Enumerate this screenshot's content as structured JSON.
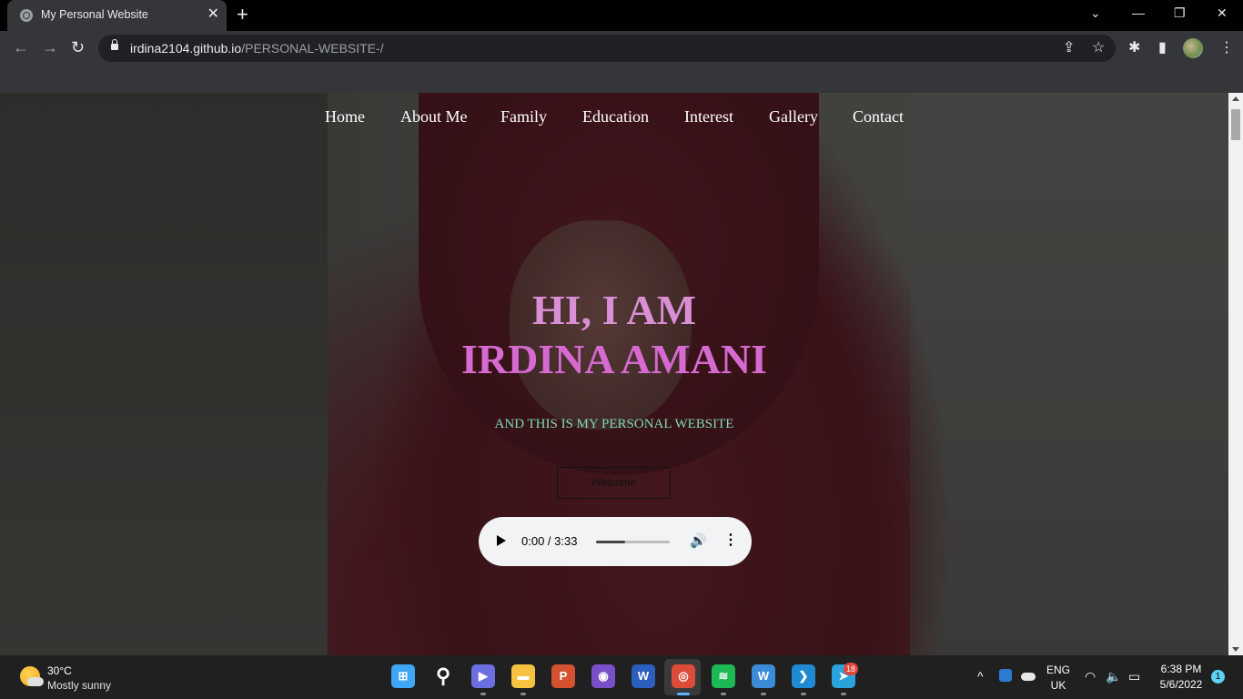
{
  "browser": {
    "tab_title": "My Personal Website",
    "tab_close": "✕",
    "new_tab": "+",
    "url_host": "irdina2104.github.io",
    "url_path": "/PERSONAL-WEBSITE-/",
    "window_controls": {
      "dropdown": "⌄",
      "minimize": "—",
      "restore": "❐",
      "close": "✕"
    },
    "nav": {
      "back": "←",
      "forward": "→",
      "reload": "↻"
    },
    "toolbar_icons": {
      "share": "⇪",
      "star": "☆",
      "extensions": "✱",
      "sidepanel": "▮",
      "menu": "⋮"
    }
  },
  "site": {
    "nav_items": [
      "Home",
      "About Me",
      "Family",
      "Education",
      "Interest",
      "Gallery",
      "Contact"
    ],
    "hero_line1": "HI, I AM",
    "hero_line2": "IRDINA AMANI",
    "subtitle": "AND THIS IS MY PERSONAL WEBSITE",
    "welcome_button": "Welcome",
    "audio": {
      "time": "0:00 / 3:33",
      "progress": 0.4,
      "volume_icon": "🔊",
      "more_icon": "⋮"
    }
  },
  "taskbar": {
    "weather_temp": "30°C",
    "weather_desc": "Mostly sunny",
    "apps": [
      {
        "name": "windows-start",
        "color": "#3ea6f5",
        "glyph": "⊞"
      },
      {
        "name": "search",
        "color": "transparent",
        "glyph": "⚲"
      },
      {
        "name": "teams-chat",
        "color": "#6b6fe0",
        "glyph": "▶"
      },
      {
        "name": "file-explorer",
        "color": "#f5c242",
        "glyph": "▬"
      },
      {
        "name": "powerpoint",
        "color": "#d35230",
        "glyph": "P"
      },
      {
        "name": "github-desktop",
        "color": "#7b4fc7",
        "glyph": "◉"
      },
      {
        "name": "word",
        "color": "#2b5fbd",
        "glyph": "W"
      },
      {
        "name": "chrome",
        "color": "#dd4b39",
        "glyph": "◎"
      },
      {
        "name": "spotify",
        "color": "#1db954",
        "glyph": "≋"
      },
      {
        "name": "webex",
        "color": "#3c8bd6",
        "glyph": "W"
      },
      {
        "name": "vscode",
        "color": "#1f8ad2",
        "glyph": "❯"
      },
      {
        "name": "telegram",
        "color": "#2aa3dd",
        "glyph": "➤"
      }
    ],
    "telegram_badge": "18",
    "tray_chevron": "^",
    "lang_line1": "ENG",
    "lang_line2": "UK",
    "time": "6:38 PM",
    "date": "5/6/2022",
    "notifications": "1",
    "tray_icons": {
      "wifi": "◠",
      "volume": "🔈",
      "battery": "▭"
    }
  }
}
